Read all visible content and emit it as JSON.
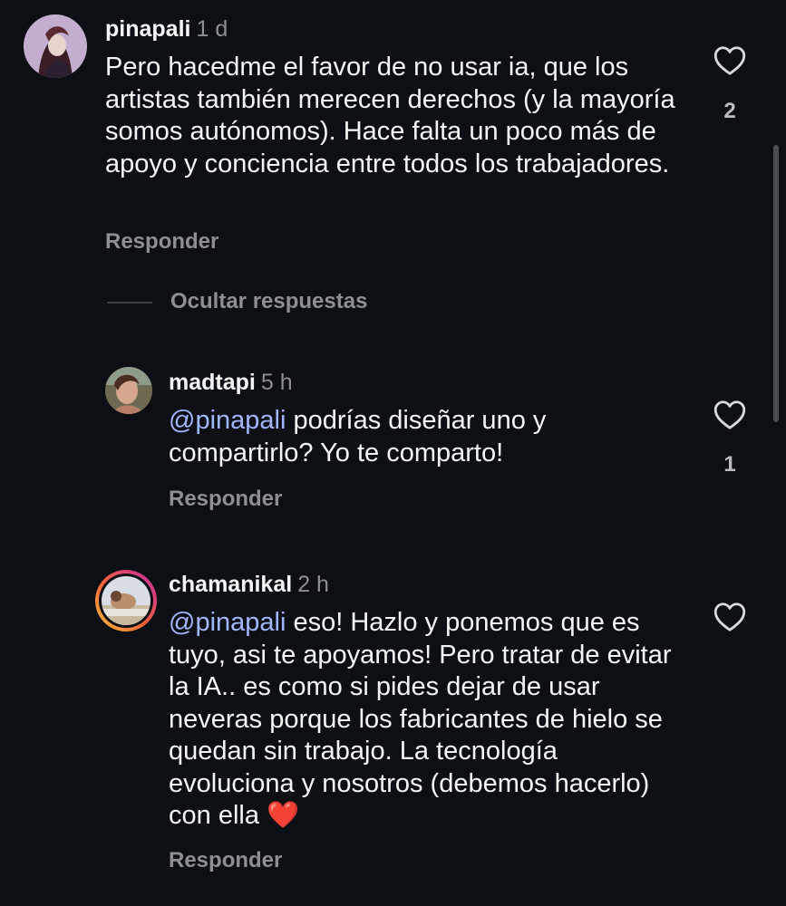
{
  "comments": [
    {
      "username": "pinapali",
      "time": "1 d",
      "text": "Pero hacedme el favor de no usar ia, que los artistas también merecen derechos (y la mayoría somos autónomos). Hace falta un poco más de apoyo y conciencia entre todos los trabajadores.",
      "reply_label": "Responder",
      "likes": "2"
    }
  ],
  "hide_replies_label": "Ocultar respuestas",
  "replies": [
    {
      "username": "madtapi",
      "time": "5 h",
      "mention": "@pinapali",
      "text": " podrías diseñar uno y compartirlo? Yo te comparto!",
      "reply_label": "Responder",
      "likes": "1"
    },
    {
      "username": "chamanikal",
      "time": "2 h",
      "mention": "@pinapali",
      "text": " eso! Hazlo y ponemos que es tuyo, asi te apoyamos! Pero tratar de evitar la IA.. es como si pides dejar de usar neveras porque los fabricantes de hielo se quedan sin trabajo. La tecnología evoluciona y nosotros (debemos hacerlo) con ella ",
      "emoji": "❤️",
      "reply_label": "Responder",
      "likes": ""
    }
  ],
  "icons": {
    "like": "heart-outline-icon",
    "story_ring": "story-ring-icon"
  },
  "colors": {
    "background": "#0c0f14",
    "mention": "#a2b5ff",
    "secondary_text": "#8e8e93",
    "heart_emoji": "#e0262b"
  }
}
